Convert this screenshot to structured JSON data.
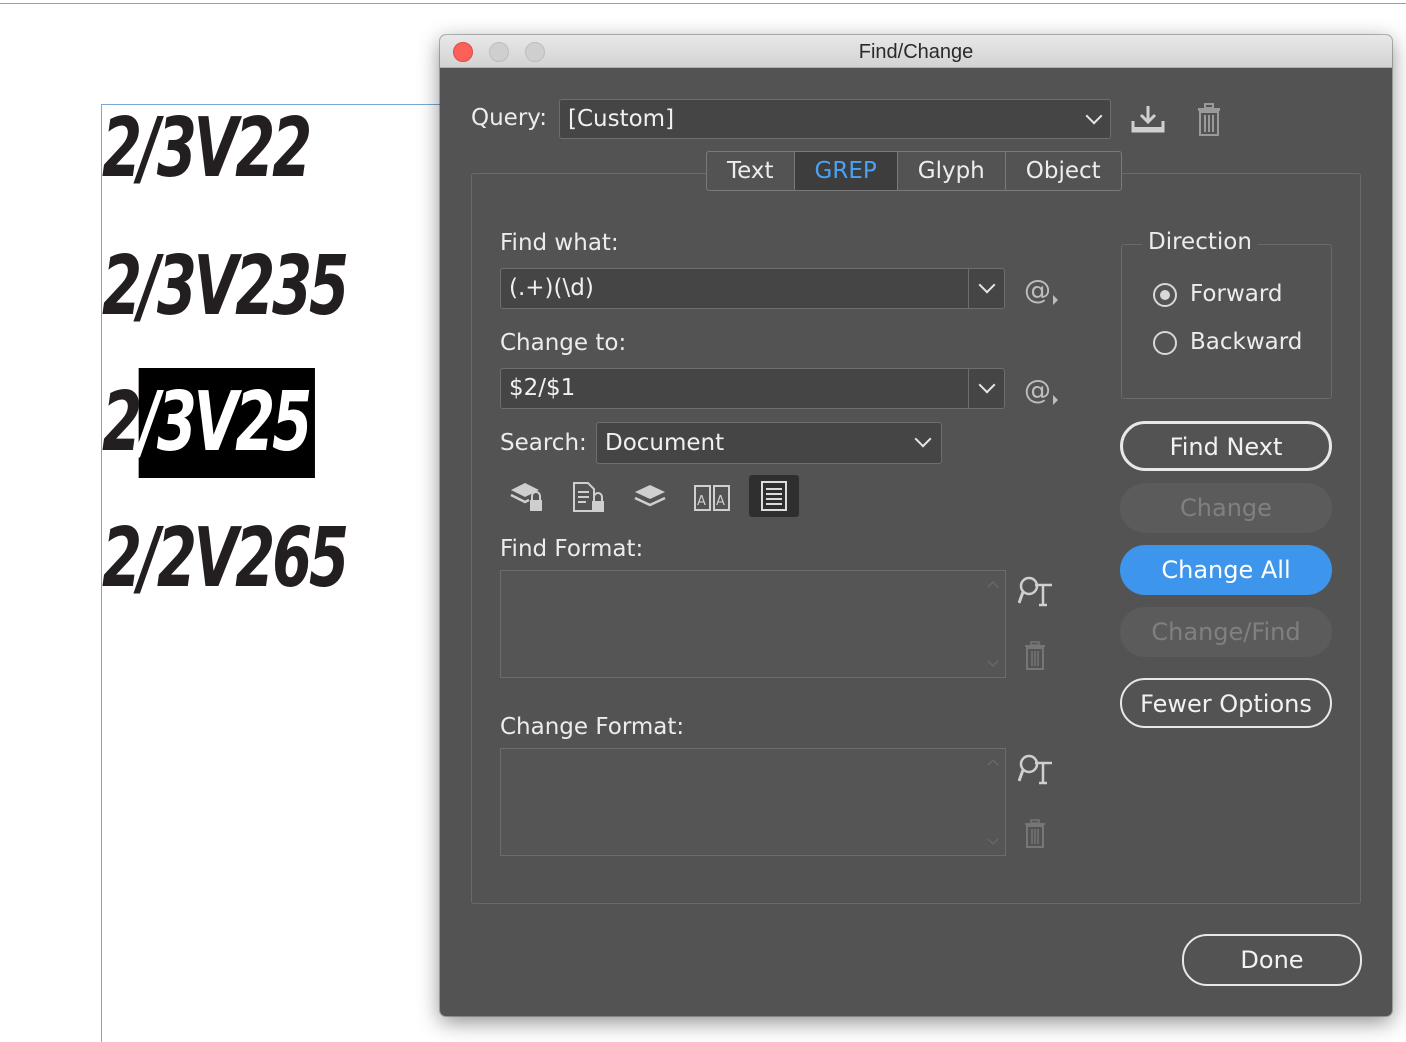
{
  "document": {
    "lines": [
      {
        "before": "2/3V22",
        "selected": "",
        "after": ""
      },
      {
        "before": "2/3V235",
        "selected": "",
        "after": ""
      },
      {
        "before": "2",
        "selected": "/3V25",
        "after": ""
      },
      {
        "before": "2/2V265",
        "selected": "",
        "after": ""
      }
    ]
  },
  "dialog": {
    "title": "Find/Change",
    "query": {
      "label": "Query:",
      "value": "[Custom]"
    },
    "tabs": [
      {
        "label": "Text",
        "active": false
      },
      {
        "label": "GREP",
        "active": true
      },
      {
        "label": "Glyph",
        "active": false
      },
      {
        "label": "Object",
        "active": false
      }
    ],
    "find_what": {
      "label": "Find what:",
      "value": "(.+)(\\d)"
    },
    "change_to": {
      "label": "Change to:",
      "value": "$2/$1"
    },
    "search": {
      "label": "Search:",
      "value": "Document"
    },
    "find_format": {
      "label": "Find Format:"
    },
    "change_format": {
      "label": "Change Format:"
    },
    "direction": {
      "label": "Direction",
      "options": [
        {
          "label": "Forward",
          "selected": true
        },
        {
          "label": "Backward",
          "selected": false
        }
      ]
    },
    "buttons": {
      "find_next": "Find Next",
      "change": "Change",
      "change_all": "Change All",
      "change_find": "Change/Find",
      "fewer_options": "Fewer Options",
      "done": "Done"
    },
    "colors": {
      "dialog_bg": "#535353",
      "accent_blue": "#3d96ec",
      "active_tab_text": "#4aa2f5",
      "close_button": "#fc605b"
    }
  }
}
